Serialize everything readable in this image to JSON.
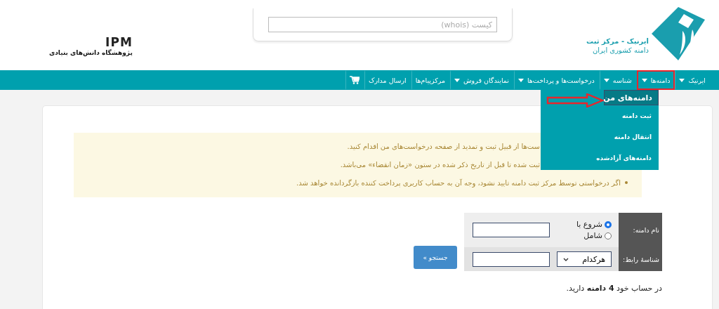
{
  "header": {
    "logo": {
      "title": "ایرنیک - مرکز ثبت",
      "subtitle": "دامنه کشوری ایران"
    },
    "whois": {
      "placeholder": "کیست (whois)"
    },
    "partner": {
      "name": "IPM",
      "caption": "پژوهشگاه دانش‌های بنیادی"
    }
  },
  "nav": {
    "items": [
      {
        "label": "ایرنیک",
        "caret": true,
        "highlighted": false
      },
      {
        "label": "دامنه‌ها",
        "caret": true,
        "highlighted": true
      },
      {
        "label": "شناسه",
        "caret": true,
        "highlighted": false
      },
      {
        "label": "درخواست‌ها و پرداخت‌ها",
        "caret": true,
        "highlighted": false
      },
      {
        "label": "نمایندگان فروش",
        "caret": true,
        "highlighted": false
      },
      {
        "label": "مرکزپیام‌ها",
        "caret": false,
        "highlighted": false
      },
      {
        "label": "ارسال مدارک",
        "caret": false,
        "highlighted": false
      }
    ]
  },
  "dropdown": {
    "items": [
      {
        "label": "دامنه‌های من",
        "selected": true,
        "pointed": true
      },
      {
        "label": "ثبت دامنه",
        "selected": false,
        "pointed": false
      },
      {
        "label": "انتقال دامنه",
        "selected": false,
        "pointed": false
      },
      {
        "label": "دامنه‌های آزادشده",
        "selected": false,
        "pointed": false
      }
    ]
  },
  "alert": {
    "lines": [
      {
        "text": "ست‌ها از قبیل ثبت و تمدید از صفحه درخواست‌های من اقدام کنید.",
        "bullet": false
      },
      {
        "text": "ثبت شده تا قبل از تاریخ ذکر شده در ستون «زمان انقضاء» می‌باشد.",
        "bullet": false
      },
      {
        "text": "اگر درخواستی توسط مرکز ثبت دامنه تایید نشود، وجه آن به حساب کاربری پرداخت کننده بازگردانده خواهد شد.",
        "bullet": true
      }
    ]
  },
  "search": {
    "name_label": "نام دامنه:",
    "options": [
      {
        "label": "شروع با",
        "selected": true
      },
      {
        "label": "شامل",
        "selected": false
      }
    ],
    "contact_label": "شناسهٔ رابط:",
    "contact_select": "هرکدام",
    "button": "جستجو »"
  },
  "summary": "در حساب خود **4 دامنه** دارید."
}
